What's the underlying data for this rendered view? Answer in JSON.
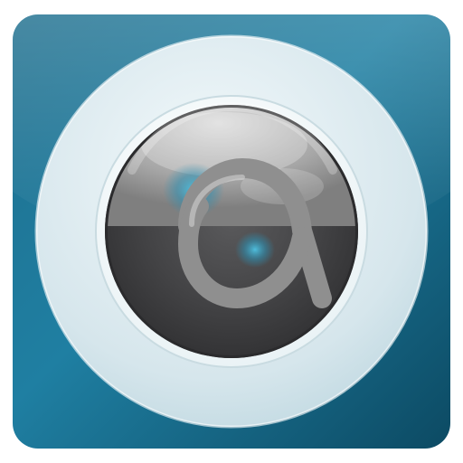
{
  "icon": {
    "name": "camera-lens-app-icon",
    "glyph": "a",
    "colors": {
      "tile_light": "#2f93b6",
      "tile_mid": "#1e7796",
      "tile_dark": "#0f4f68",
      "ring_outer": "#dbe9ee",
      "ring_inner": "#f6fbfc",
      "lens_light": "#a9a9a9",
      "lens_mid": "#6b6b6b",
      "lens_dark": "#3b3b3d",
      "glyph": "#8f8f8f",
      "reflection": "#3aa6c6"
    }
  }
}
